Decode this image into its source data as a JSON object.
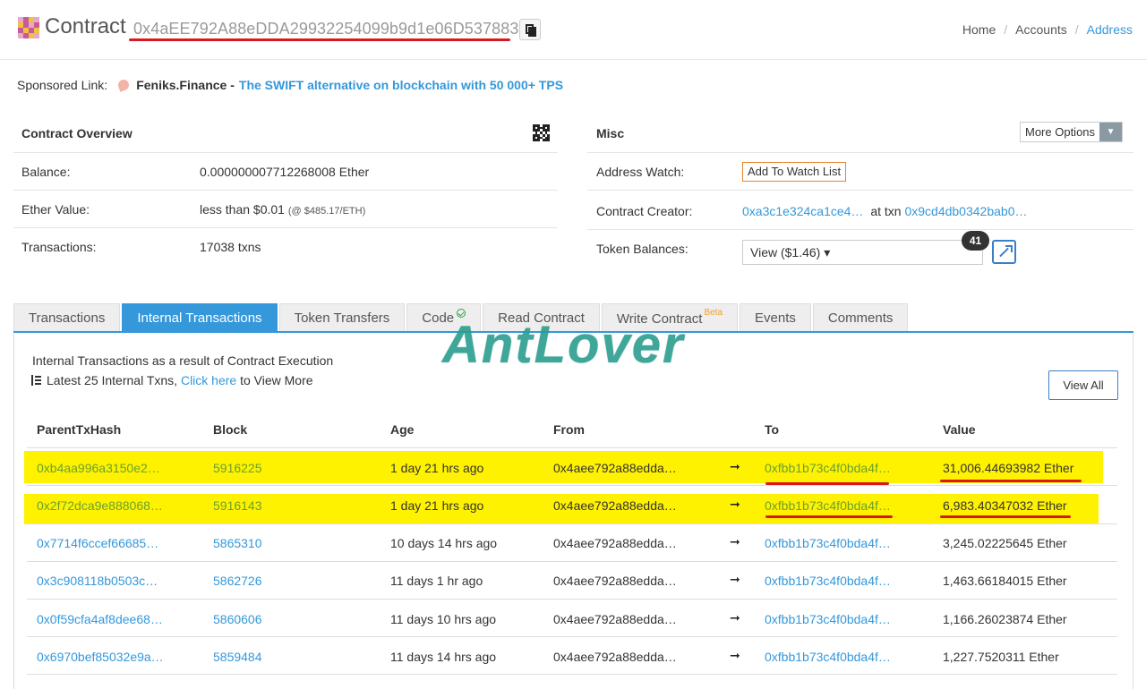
{
  "header": {
    "title": "Contract",
    "address": "0x4aEE792A88eDDA29932254099b9d1e06D537883f",
    "breadcrumb": [
      "Home",
      "Accounts",
      "Address"
    ]
  },
  "sponsored": {
    "label": "Sponsored Link:",
    "name": "Feniks.Finance -",
    "tagline": "The SWIFT alternative on blockchain with 50 000+ TPS"
  },
  "overview": {
    "title": "Contract Overview",
    "rows": [
      {
        "label": "Balance:",
        "value": "0.000000007712268008 Ether"
      },
      {
        "label": "Ether Value:",
        "value": "less than $0.01",
        "sub": "(@ $485.17/ETH)"
      },
      {
        "label": "Transactions:",
        "value": "17038 txns"
      }
    ]
  },
  "misc": {
    "title": "Misc",
    "more_options": "More Options",
    "address_watch_label": "Address Watch:",
    "watch_button": "Add To Watch List",
    "creator_label": "Contract Creator:",
    "creator_address": "0xa3c1e324ca1ce4…",
    "creator_at": "at txn",
    "creator_txn": "0x9cd4db0342bab0…",
    "token_label": "Token Balances:",
    "token_select": "View ($1.46) ▾",
    "token_count": "41"
  },
  "tabs": [
    {
      "label": "Transactions"
    },
    {
      "label": "Internal Transactions"
    },
    {
      "label": "Token Transfers"
    },
    {
      "label": "Code"
    },
    {
      "label": "Read Contract"
    },
    {
      "label": "Write Contract",
      "badge": "Beta"
    },
    {
      "label": "Events"
    },
    {
      "label": "Comments"
    }
  ],
  "watermark": "AntLover",
  "internal": {
    "intro": "Internal Transactions as a result of Contract Execution",
    "latest": "Latest 25 Internal Txns,",
    "click_here": "Click here",
    "view_more": "to View More",
    "view_all": "View All",
    "columns": [
      "ParentTxHash",
      "Block",
      "Age",
      "From",
      "To",
      "Value"
    ],
    "rows": [
      {
        "hash": "0xb4aa996a3150e2…",
        "block": "5916225",
        "age": "1 day 21 hrs ago",
        "from": "0x4aee792a88edda…",
        "to": "0xfbb1b73c4f0bda4f…",
        "value": "31,006.44693982 Ether",
        "highlight": true
      },
      {
        "hash": "0x2f72dca9e888068…",
        "block": "5916143",
        "age": "1 day 21 hrs ago",
        "from": "0x4aee792a88edda…",
        "to": "0xfbb1b73c4f0bda4f…",
        "value": "6,983.40347032 Ether",
        "highlight": true
      },
      {
        "hash": "0x7714f6ccef66685…",
        "block": "5865310",
        "age": "10 days 14 hrs ago",
        "from": "0x4aee792a88edda…",
        "to": "0xfbb1b73c4f0bda4f…",
        "value": "3,245.02225645 Ether",
        "highlight": false
      },
      {
        "hash": "0x3c908118b0503c…",
        "block": "5862726",
        "age": "11 days 1 hr ago",
        "from": "0x4aee792a88edda…",
        "to": "0xfbb1b73c4f0bda4f…",
        "value": "1,463.66184015 Ether",
        "highlight": false
      },
      {
        "hash": "0x0f59cfa4af8dee68…",
        "block": "5860606",
        "age": "11 days 10 hrs ago",
        "from": "0x4aee792a88edda…",
        "to": "0xfbb1b73c4f0bda4f…",
        "value": "1,166.26023874 Ether",
        "highlight": false
      },
      {
        "hash": "0x6970bef85032e9a…",
        "block": "5859484",
        "age": "11 days 14 hrs ago",
        "from": "0x4aee792a88edda…",
        "to": "0xfbb1b73c4f0bda4f…",
        "value": "1,227.7520311 Ether",
        "highlight": false
      }
    ]
  }
}
